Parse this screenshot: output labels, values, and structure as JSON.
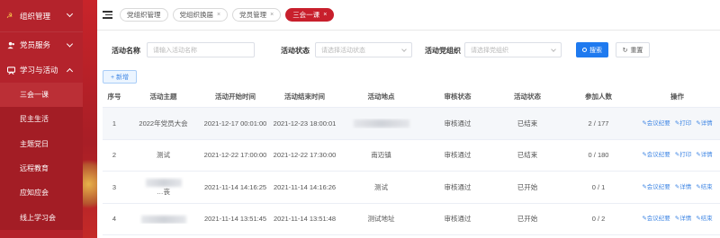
{
  "sidebar": {
    "top_item": "组织管理",
    "items": [
      {
        "label": "党员服务",
        "icon": "users-icon"
      },
      {
        "label": "学习与活动",
        "icon": "meeting-icon"
      }
    ],
    "sub_items": [
      {
        "label": "三会一课",
        "active": true
      },
      {
        "label": "民主生活",
        "active": false
      },
      {
        "label": "主题党日",
        "active": false
      },
      {
        "label": "远程教育",
        "active": false
      },
      {
        "label": "应知应会",
        "active": false
      },
      {
        "label": "线上学习会",
        "active": false
      }
    ]
  },
  "tags": [
    {
      "label": "党组织管理",
      "closable": false,
      "active": false
    },
    {
      "label": "党组织换届",
      "closable": true,
      "active": false
    },
    {
      "label": "党员管理",
      "closable": true,
      "active": false
    },
    {
      "label": "三会一课",
      "closable": true,
      "active": true
    }
  ],
  "filters": {
    "name_label": "活动名称",
    "name_placeholder": "请输入活动名称",
    "status_label": "活动状态",
    "status_placeholder": "请选择活动状态",
    "org_label": "活动党组织",
    "org_placeholder": "请选择党组织",
    "search_label": "搜索",
    "reset_label": "重置"
  },
  "add_label": "+ 新增",
  "table": {
    "columns": [
      "序号",
      "活动主题",
      "活动开始时间",
      "活动结束时间",
      "活动地点",
      "审核状态",
      "活动状态",
      "参加人数",
      "操作"
    ],
    "rows": [
      {
        "no": "1",
        "title": "2022年党员大会",
        "start": "2021-12-17 00:01:00",
        "end": "2021-12-23 18:00:01",
        "place": "",
        "audit": "审核通过",
        "status": "已结束",
        "count": "2 / 177",
        "ops": [
          "会议纪要",
          "打印",
          "详情"
        ]
      },
      {
        "no": "2",
        "title": "测试",
        "start": "2021-12-22 17:00:00",
        "end": "2021-12-22 17:30:00",
        "place": "南迈镇",
        "audit": "审核通过",
        "status": "已结束",
        "count": "0 / 180",
        "ops": [
          "会议纪要",
          "打印",
          "详情"
        ]
      },
      {
        "no": "3",
        "title": "…丧",
        "start": "2021-11-14 14:16:25",
        "end": "2021-11-14 14:16:26",
        "place": "测试",
        "audit": "审核通过",
        "status": "已开始",
        "count": "0 / 1",
        "ops": [
          "会议纪要",
          "详情",
          "结束"
        ]
      },
      {
        "no": "4",
        "title": "",
        "start": "2021-11-14 13:51:45",
        "end": "2021-11-14 13:51:48",
        "place": "测试地址",
        "audit": "审核通过",
        "status": "已开始",
        "count": "0 / 2",
        "ops": [
          "会议纪要",
          "详情",
          "结束"
        ]
      }
    ]
  },
  "colors": {
    "sidebar": "#b4232c",
    "active_tag": "#c81f2c",
    "primary": "#1f7aef",
    "link": "#3f86e4"
  }
}
